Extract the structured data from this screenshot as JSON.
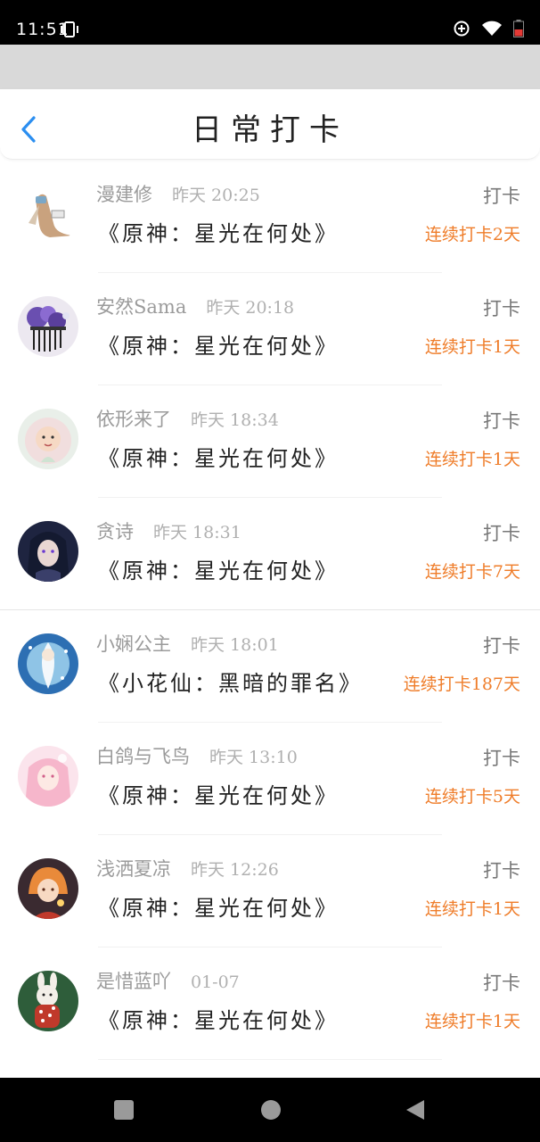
{
  "status_bar": {
    "time": "11:51"
  },
  "header": {
    "title": "日常打卡"
  },
  "entries": [
    {
      "user": "漫建修",
      "time": "昨天 20:25",
      "book": "《原神：星光在何处》",
      "action": "打卡",
      "streak": "连续打卡2天"
    },
    {
      "user": "安然Sama",
      "time": "昨天 20:18",
      "book": "《原神：星光在何处》",
      "action": "打卡",
      "streak": "连续打卡1天"
    },
    {
      "user": "依形来了",
      "time": "昨天 18:34",
      "book": "《原神：星光在何处》",
      "action": "打卡",
      "streak": "连续打卡1天"
    },
    {
      "user": "贪诗",
      "time": "昨天 18:31",
      "book": "《原神：星光在何处》",
      "action": "打卡",
      "streak": "连续打卡7天"
    },
    {
      "user": "小娴公主",
      "time": "昨天 18:01",
      "book": "《小花仙：黑暗的罪名》",
      "action": "打卡",
      "streak": "连续打卡187天"
    },
    {
      "user": "白鸽与飞鸟",
      "time": "昨天 13:10",
      "book": "《原神：星光在何处》",
      "action": "打卡",
      "streak": "连续打卡5天"
    },
    {
      "user": "浅洒夏凉",
      "time": "昨天 12:26",
      "book": "《原神：星光在何处》",
      "action": "打卡",
      "streak": "连续打卡1天"
    },
    {
      "user": "是惜蓝吖",
      "time": "01-07",
      "book": "《原神：星光在何处》",
      "action": "打卡",
      "streak": "连续打卡1天"
    }
  ],
  "colors": {
    "accent_back": "#2b8ef0",
    "streak": "#ef7d2a"
  },
  "icons": [
    "back-arrow-icon",
    "vibrate-icon",
    "data-saver-icon",
    "wifi-icon",
    "battery-icon",
    "nav-recents-icon",
    "nav-home-icon",
    "nav-back-icon"
  ]
}
